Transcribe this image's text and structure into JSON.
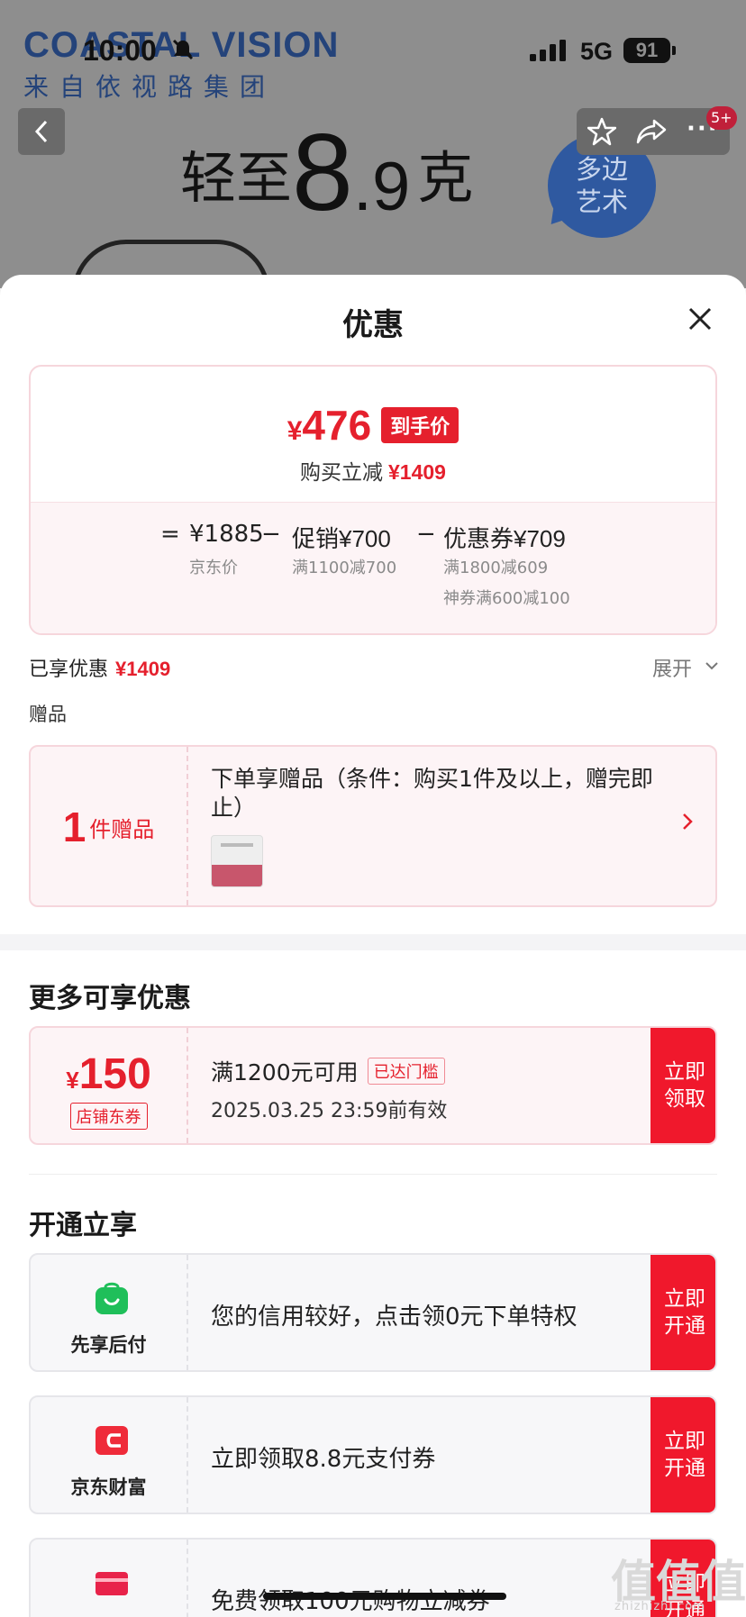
{
  "background": {
    "brand_name": "COASTAL VISION",
    "brand_sub": "来自依视路集团",
    "promo_pre": "轻至",
    "promo_big": "8",
    "promo_small": ".9",
    "promo_unit": "克",
    "bubble_line1": "多边",
    "bubble_line2": "艺术"
  },
  "status_bar": {
    "time": "10:00",
    "network": "5G",
    "battery": "91"
  },
  "header": {
    "more": "···",
    "badge": "5+"
  },
  "sheet": {
    "title": "优惠",
    "price": {
      "yen": "¥",
      "final_price": "476",
      "tag": "到手价",
      "save_label": "购买立减",
      "save_amount": "¥1409"
    },
    "formula": {
      "equals": "=",
      "base_amount": "¥1885",
      "base_label": "京东价",
      "minus1": "−",
      "promo_label": "促销",
      "promo_amount": "¥700",
      "promo_note": "满1100减700",
      "minus2": "−",
      "coupon_label": "优惠券",
      "coupon_amount": "¥709",
      "coupon_note1": "满1800减609",
      "coupon_note2": "神券满600减100"
    },
    "enjoyed": {
      "label": "已享优惠",
      "amount": "¥1409",
      "expand": "展开"
    },
    "gift": {
      "section_label": "赠品",
      "count": "1",
      "unit": "件赠品",
      "desc": "下单享赠品（条件：购买1件及以上，赠完即止）"
    },
    "more_offers": {
      "title": "更多可享优惠",
      "coupon": {
        "yen": "¥",
        "amount": "150",
        "type": "店铺东券",
        "condition": "满1200元可用",
        "badge": "已达门槛",
        "expire": "2025.03.25 23:59前有效",
        "action": "立即领取"
      }
    },
    "open_enjoy": {
      "title": "开通立享",
      "items": [
        {
          "label": "先享后付",
          "desc": "您的信用较好，点击领0元下单特权",
          "action": "立即开通",
          "icon_color": "#1fbf5a"
        },
        {
          "label": "京东财富",
          "desc": "立即领取8.8元支付券",
          "action": "立即开通",
          "icon_color": "#ef2b3a"
        },
        {
          "label": "",
          "desc": "免费领取100元购物立减券",
          "action": "立即开通",
          "icon_color": "#e8234a"
        }
      ]
    }
  },
  "watermark": {
    "text": "值值值",
    "sub": "zhizhizhi.com"
  },
  "colors": {
    "accent_red": "#e5202d",
    "button_red": "#f0182c",
    "brand_blue": "#24437a"
  }
}
